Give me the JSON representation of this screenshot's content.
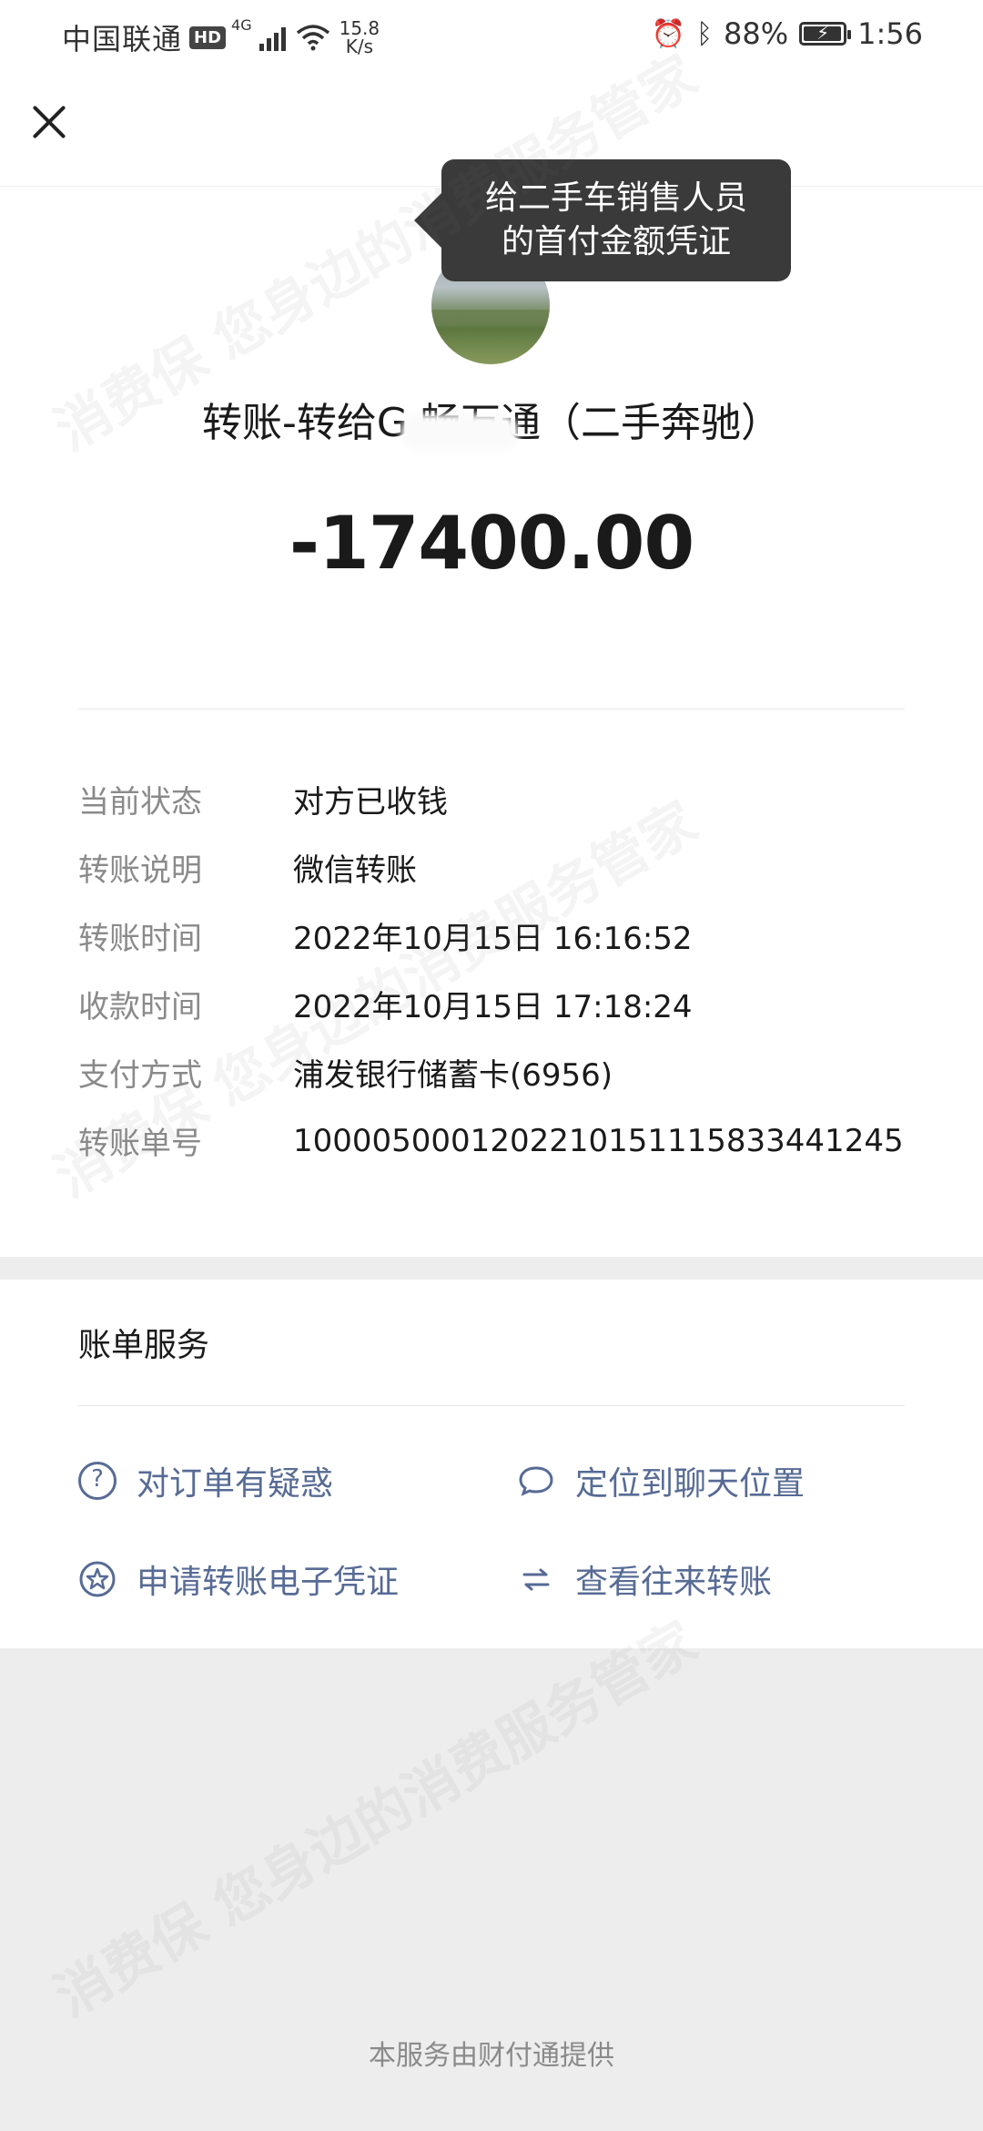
{
  "status_bar": {
    "carrier": "中国联通",
    "hd": "HD",
    "net_type": "4G",
    "speed_value": "15.8",
    "speed_unit": "K/s",
    "battery": "88%",
    "time": "1:56"
  },
  "tooltip": "给二手车销售人员的首付金额凭证",
  "payee": "转账-转给G 畅万通（二手奔驰）",
  "amount": "-17400.00",
  "details": [
    {
      "label": "当前状态",
      "value": "对方已收钱"
    },
    {
      "label": "转账说明",
      "value": "微信转账"
    },
    {
      "label": "转账时间",
      "value": "2022年10月15日 16:16:52"
    },
    {
      "label": "收款时间",
      "value": "2022年10月15日 17:18:24"
    },
    {
      "label": "支付方式",
      "value": "浦发银行储蓄卡(6956)"
    },
    {
      "label": "转账单号",
      "value": "1000050001202210151115833441245"
    }
  ],
  "bill_services": {
    "title": "账单服务",
    "items": [
      {
        "icon": "question-icon",
        "label": "对订单有疑惑"
      },
      {
        "icon": "chat-bubble-icon",
        "label": "定位到聊天位置"
      },
      {
        "icon": "star-badge-icon",
        "label": "申请转账电子凭证"
      },
      {
        "icon": "exchange-arrows-icon",
        "label": "查看往来转账"
      }
    ]
  },
  "footer": "本服务由财付通提供",
  "watermark": "消费保 您身边的消费服务管家",
  "colors": {
    "link": "#576b95",
    "label": "#8a8a8a",
    "background": "#ededed"
  }
}
